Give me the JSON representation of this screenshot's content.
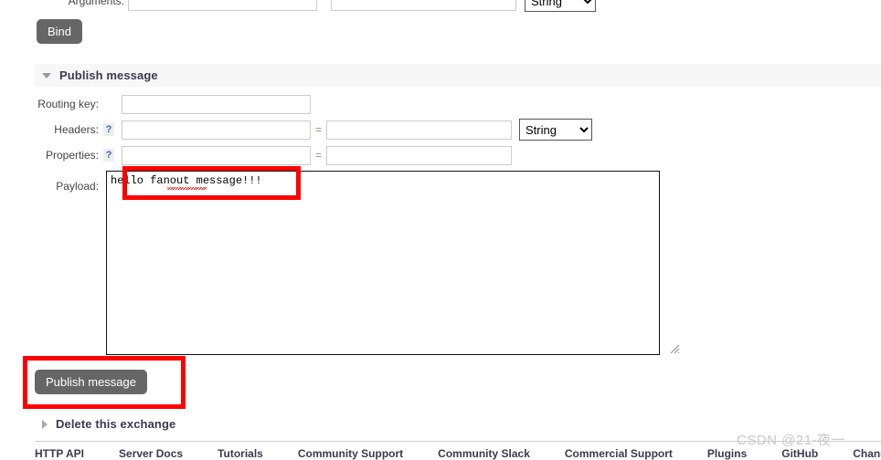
{
  "bind_form": {
    "arguments_label": "Arguments:",
    "arg_key_value": "",
    "arg_value_value": "",
    "arg_type_selected": "String",
    "bind_button_label": "Bind"
  },
  "publish_section": {
    "title": "Publish message",
    "expanded_marker": "down-triangle",
    "routing_key_label": "Routing key:",
    "routing_key_value": "",
    "headers_label": "Headers:",
    "headers_help": "?",
    "header_key_value": "",
    "header_value_value": "",
    "headers_type_selected": "String",
    "properties_label": "Properties:",
    "properties_help": "?",
    "property_key_value": "",
    "property_value_value": "",
    "equals_sign": "=",
    "payload_label": "Payload:",
    "payload_value": "hello fanout message!!!",
    "publish_button_label": "Publish message"
  },
  "delete_section": {
    "title": "Delete this exchange",
    "collapsed_marker": "right-triangle"
  },
  "footer": {
    "links": [
      "HTTP API",
      "Server Docs",
      "Tutorials",
      "Community Support",
      "Community Slack",
      "Commercial Support",
      "Plugins",
      "GitHub",
      "Changelog"
    ]
  },
  "watermark": {
    "text": "CSDN @21-夜一"
  },
  "colors": {
    "button_bg": "#666666",
    "annotation_red": "#ff0000",
    "section_band": "#f7f7f7",
    "help_link": "#3366cc",
    "heading_text": "#3b3b4f"
  }
}
